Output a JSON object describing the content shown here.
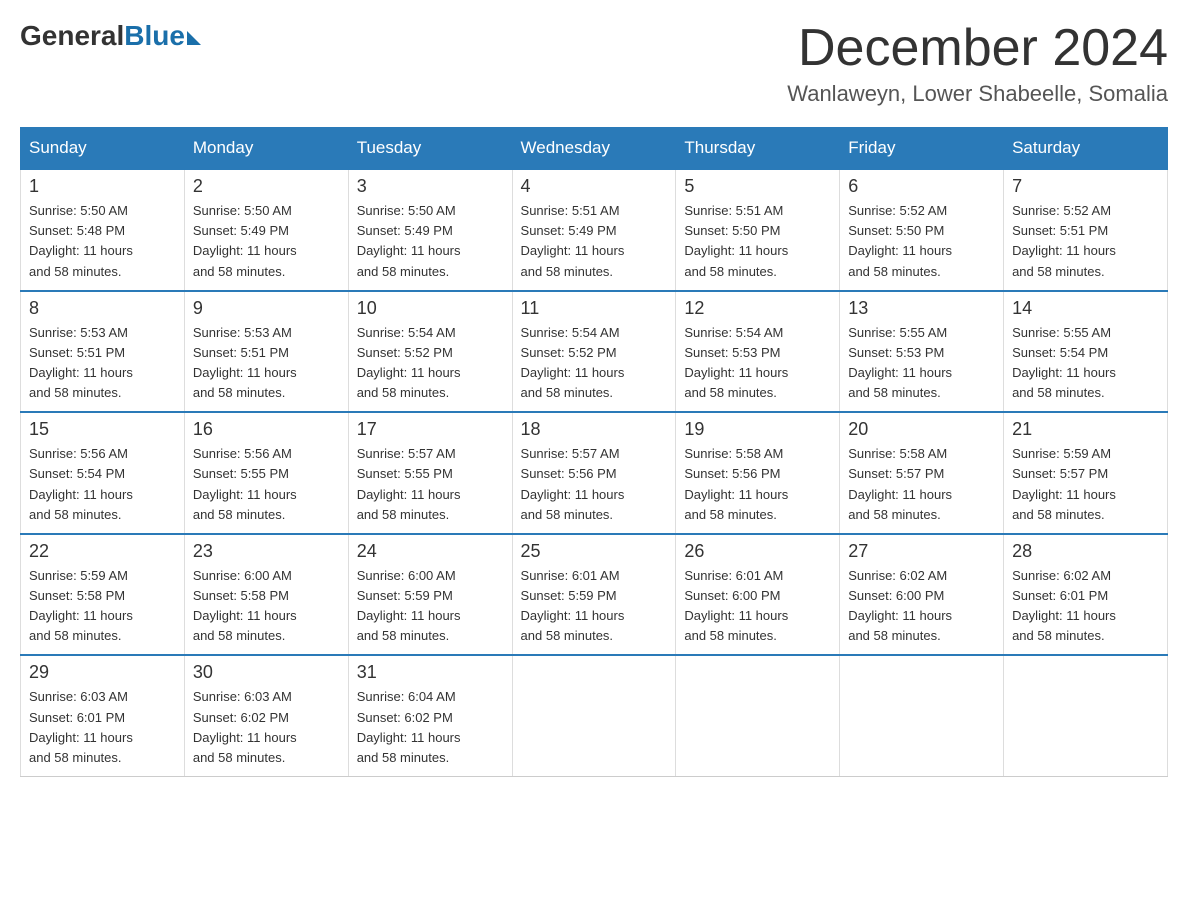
{
  "header": {
    "logo_general": "General",
    "logo_blue": "Blue",
    "month_title": "December 2024",
    "location": "Wanlaweyn, Lower Shabeelle, Somalia"
  },
  "calendar": {
    "days_of_week": [
      "Sunday",
      "Monday",
      "Tuesday",
      "Wednesday",
      "Thursday",
      "Friday",
      "Saturday"
    ],
    "weeks": [
      [
        {
          "day": "1",
          "sunrise": "5:50 AM",
          "sunset": "5:48 PM",
          "daylight": "11 hours and 58 minutes."
        },
        {
          "day": "2",
          "sunrise": "5:50 AM",
          "sunset": "5:49 PM",
          "daylight": "11 hours and 58 minutes."
        },
        {
          "day": "3",
          "sunrise": "5:50 AM",
          "sunset": "5:49 PM",
          "daylight": "11 hours and 58 minutes."
        },
        {
          "day": "4",
          "sunrise": "5:51 AM",
          "sunset": "5:49 PM",
          "daylight": "11 hours and 58 minutes."
        },
        {
          "day": "5",
          "sunrise": "5:51 AM",
          "sunset": "5:50 PM",
          "daylight": "11 hours and 58 minutes."
        },
        {
          "day": "6",
          "sunrise": "5:52 AM",
          "sunset": "5:50 PM",
          "daylight": "11 hours and 58 minutes."
        },
        {
          "day": "7",
          "sunrise": "5:52 AM",
          "sunset": "5:51 PM",
          "daylight": "11 hours and 58 minutes."
        }
      ],
      [
        {
          "day": "8",
          "sunrise": "5:53 AM",
          "sunset": "5:51 PM",
          "daylight": "11 hours and 58 minutes."
        },
        {
          "day": "9",
          "sunrise": "5:53 AM",
          "sunset": "5:51 PM",
          "daylight": "11 hours and 58 minutes."
        },
        {
          "day": "10",
          "sunrise": "5:54 AM",
          "sunset": "5:52 PM",
          "daylight": "11 hours and 58 minutes."
        },
        {
          "day": "11",
          "sunrise": "5:54 AM",
          "sunset": "5:52 PM",
          "daylight": "11 hours and 58 minutes."
        },
        {
          "day": "12",
          "sunrise": "5:54 AM",
          "sunset": "5:53 PM",
          "daylight": "11 hours and 58 minutes."
        },
        {
          "day": "13",
          "sunrise": "5:55 AM",
          "sunset": "5:53 PM",
          "daylight": "11 hours and 58 minutes."
        },
        {
          "day": "14",
          "sunrise": "5:55 AM",
          "sunset": "5:54 PM",
          "daylight": "11 hours and 58 minutes."
        }
      ],
      [
        {
          "day": "15",
          "sunrise": "5:56 AM",
          "sunset": "5:54 PM",
          "daylight": "11 hours and 58 minutes."
        },
        {
          "day": "16",
          "sunrise": "5:56 AM",
          "sunset": "5:55 PM",
          "daylight": "11 hours and 58 minutes."
        },
        {
          "day": "17",
          "sunrise": "5:57 AM",
          "sunset": "5:55 PM",
          "daylight": "11 hours and 58 minutes."
        },
        {
          "day": "18",
          "sunrise": "5:57 AM",
          "sunset": "5:56 PM",
          "daylight": "11 hours and 58 minutes."
        },
        {
          "day": "19",
          "sunrise": "5:58 AM",
          "sunset": "5:56 PM",
          "daylight": "11 hours and 58 minutes."
        },
        {
          "day": "20",
          "sunrise": "5:58 AM",
          "sunset": "5:57 PM",
          "daylight": "11 hours and 58 minutes."
        },
        {
          "day": "21",
          "sunrise": "5:59 AM",
          "sunset": "5:57 PM",
          "daylight": "11 hours and 58 minutes."
        }
      ],
      [
        {
          "day": "22",
          "sunrise": "5:59 AM",
          "sunset": "5:58 PM",
          "daylight": "11 hours and 58 minutes."
        },
        {
          "day": "23",
          "sunrise": "6:00 AM",
          "sunset": "5:58 PM",
          "daylight": "11 hours and 58 minutes."
        },
        {
          "day": "24",
          "sunrise": "6:00 AM",
          "sunset": "5:59 PM",
          "daylight": "11 hours and 58 minutes."
        },
        {
          "day": "25",
          "sunrise": "6:01 AM",
          "sunset": "5:59 PM",
          "daylight": "11 hours and 58 minutes."
        },
        {
          "day": "26",
          "sunrise": "6:01 AM",
          "sunset": "6:00 PM",
          "daylight": "11 hours and 58 minutes."
        },
        {
          "day": "27",
          "sunrise": "6:02 AM",
          "sunset": "6:00 PM",
          "daylight": "11 hours and 58 minutes."
        },
        {
          "day": "28",
          "sunrise": "6:02 AM",
          "sunset": "6:01 PM",
          "daylight": "11 hours and 58 minutes."
        }
      ],
      [
        {
          "day": "29",
          "sunrise": "6:03 AM",
          "sunset": "6:01 PM",
          "daylight": "11 hours and 58 minutes."
        },
        {
          "day": "30",
          "sunrise": "6:03 AM",
          "sunset": "6:02 PM",
          "daylight": "11 hours and 58 minutes."
        },
        {
          "day": "31",
          "sunrise": "6:04 AM",
          "sunset": "6:02 PM",
          "daylight": "11 hours and 58 minutes."
        },
        null,
        null,
        null,
        null
      ]
    ]
  }
}
